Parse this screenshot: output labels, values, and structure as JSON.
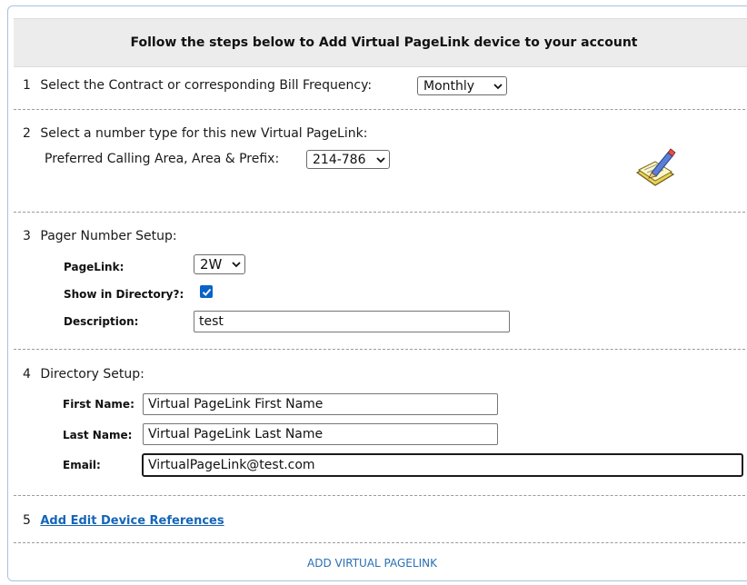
{
  "header": {
    "title": "Follow the steps below to Add Virtual PageLink device to your account"
  },
  "step1": {
    "num": "1",
    "label": "Select the Contract or corresponding Bill Frequency:",
    "select_value": "Monthly"
  },
  "step2": {
    "num": "2",
    "label": "Select a number type for this new Virtual PageLink:",
    "sublabel": "Preferred Calling Area, Area & Prefix:",
    "select_value": "214-786"
  },
  "step3": {
    "num": "3",
    "label": "Pager Number Setup:",
    "pagelink_label": "PageLink:",
    "pagelink_value": "2W",
    "directory_label": "Show in Directory?:",
    "directory_checked": true,
    "description_label": "Description:",
    "description_value": "test"
  },
  "step4": {
    "num": "4",
    "label": "Directory Setup:",
    "first_name_label": "First Name:",
    "first_name_value": "Virtual PageLink First Name",
    "last_name_label": "Last Name:",
    "last_name_value": "Virtual PageLink Last Name",
    "email_label": "Email:",
    "email_value": "VirtualPageLink@test.com"
  },
  "step5": {
    "num": "5",
    "link": "Add Edit Device References"
  },
  "footer": {
    "action": "ADD VIRTUAL PAGELINK"
  },
  "icons": {
    "edit": "notepad-pencil-icon",
    "dropdown": "chevron-down-icon",
    "check": "checkmark-icon"
  },
  "colors": {
    "link": "#1565b7",
    "checkbox": "#0a63c7",
    "header_bg": "#ececec"
  }
}
